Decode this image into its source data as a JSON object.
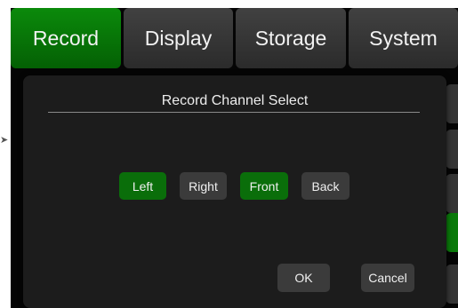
{
  "tabs": {
    "record": "Record",
    "display": "Display",
    "storage": "Storage",
    "system": "System",
    "active": "Record"
  },
  "dialog": {
    "title": "Record Channel Select",
    "channels": {
      "left": "Left",
      "right": "Right",
      "front": "Front",
      "back": "Back"
    },
    "selected_channels": [
      "Left",
      "Front"
    ],
    "ok_label": "OK",
    "cancel_label": "Cancel"
  },
  "colors": {
    "active_green": "#0a6e0a",
    "button_gray": "#3b3b3b",
    "dialog_bg": "#1c1c1c"
  }
}
